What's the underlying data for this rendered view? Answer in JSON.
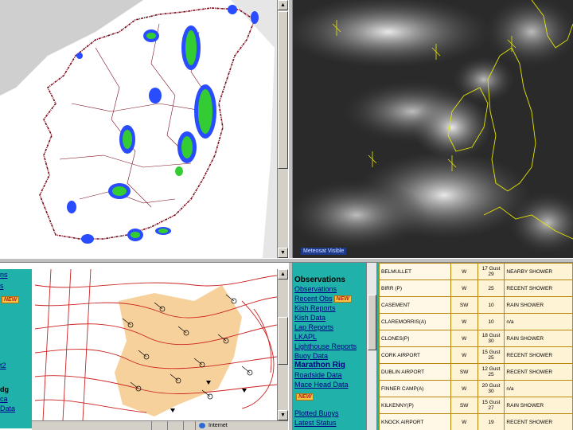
{
  "radar_panel": {
    "name": "rainfall-radar-map"
  },
  "satellite_panel": {
    "label": "Meteosat Visible"
  },
  "synoptic_panel": {
    "left_menu": {
      "items": [
        {
          "label": "ns",
          "style": "link"
        },
        {
          "label": "s",
          "style": "link"
        },
        {
          "label": "NEW",
          "style": "badge"
        },
        {
          "label": "t2",
          "style": "link"
        },
        {
          "label": "dg",
          "style": "bold"
        },
        {
          "label": "ca",
          "style": "link"
        },
        {
          "label": "Data",
          "style": "link"
        }
      ]
    },
    "status_bar": {
      "zone": "Internet"
    }
  },
  "observations_panel": {
    "title": "Observations",
    "links": [
      {
        "label": "Observations",
        "badge": ""
      },
      {
        "label": "Recent Obs",
        "badge": "NEW"
      },
      {
        "label": "Kish Reports",
        "badge": ""
      },
      {
        "label": "Kish Data",
        "badge": ""
      },
      {
        "label": "Lap Reports",
        "badge": ""
      },
      {
        "label": "LKAPL",
        "badge": ""
      },
      {
        "label": "Lighthouse Reports",
        "badge": ""
      },
      {
        "label": "Buoy Data",
        "badge": ""
      },
      {
        "label": "Marathon Rig",
        "badge": ""
      },
      {
        "label": "Roadside Data",
        "badge": ""
      },
      {
        "label": "Mace Head Data",
        "badge": "NEW"
      },
      {
        "label": "Plotted Buoys",
        "badge": ""
      },
      {
        "label": "Latest Status",
        "badge": ""
      }
    ],
    "table": {
      "rows": [
        {
          "station": "BELMULLET",
          "direction": "W",
          "speed": "17 Gust 29",
          "weather": "NEARBY SHOWER"
        },
        {
          "station": "BIRR (P)",
          "direction": "W",
          "speed": "25",
          "weather": "RECENT SHOWER"
        },
        {
          "station": "CASEMENT",
          "direction": "SW",
          "speed": "10",
          "weather": "RAIN SHOWER"
        },
        {
          "station": "CLAREMORRIS(A)",
          "direction": "W",
          "speed": "10",
          "weather": "n/a"
        },
        {
          "station": "CLONES(P)",
          "direction": "W",
          "speed": "18 Gust 30",
          "weather": "RAIN SHOWER"
        },
        {
          "station": "CORK AIRPORT",
          "direction": "W",
          "speed": "15 Gust 25",
          "weather": "RECENT SHOWER"
        },
        {
          "station": "DUBLIN AIRPORT",
          "direction": "SW",
          "speed": "12 Gust 25",
          "weather": "RECENT SHOWER"
        },
        {
          "station": "FINNER CAMP(A)",
          "direction": "W",
          "speed": "20 Gust 30",
          "weather": "n/a"
        },
        {
          "station": "KILKENNY(P)",
          "direction": "SW",
          "speed": "15 Gust 27",
          "weather": "RAIN SHOWER"
        },
        {
          "station": "KNOCK AIRPORT",
          "direction": "W",
          "speed": "19",
          "weather": "RECENT SHOWER"
        }
      ]
    }
  },
  "colors": {
    "teal_panel": "#20b2aa",
    "table_bg": "#fff3d6",
    "radar_green": "#33cc33",
    "radar_blue": "#2a4cff",
    "coast_maroon": "#7a0a1a",
    "isobar_red": "#cc2222",
    "warm_sector": "#f6c98a"
  }
}
